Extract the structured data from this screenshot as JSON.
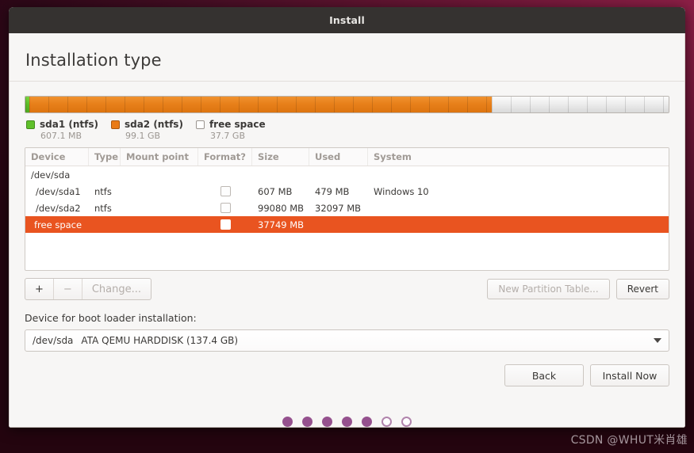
{
  "window": {
    "title": "Install"
  },
  "page": {
    "title": "Installation type"
  },
  "partition_bar": {
    "segments": [
      {
        "name": "sda1",
        "percent": 0.6,
        "color": "#5cbb28"
      },
      {
        "name": "sda2",
        "percent": 71.9,
        "color": "#e8801a"
      },
      {
        "name": "free space",
        "percent": 27.5,
        "color": "#e5e5e5"
      }
    ]
  },
  "legend": [
    {
      "label": "sda1 (ntfs)",
      "size": "607.1 MB",
      "swatch": "green-swatch-icon"
    },
    {
      "label": "sda2 (ntfs)",
      "size": "99.1 GB",
      "swatch": "orange-swatch-icon"
    },
    {
      "label": "free space",
      "size": "37.7 GB",
      "swatch": "white-swatch-icon"
    }
  ],
  "table": {
    "columns": [
      "Device",
      "Type",
      "Mount point",
      "Format?",
      "Size",
      "Used",
      "System"
    ],
    "rows": [
      {
        "device": "/dev/sda",
        "type": "",
        "mount": "",
        "format": false,
        "has_checkbox": false,
        "size": "",
        "used": "",
        "system": "",
        "selected": false
      },
      {
        "device": "/dev/sda1",
        "type": "ntfs",
        "mount": "",
        "format": false,
        "has_checkbox": true,
        "size": "607 MB",
        "used": "479 MB",
        "system": "Windows 10",
        "selected": false
      },
      {
        "device": "/dev/sda2",
        "type": "ntfs",
        "mount": "",
        "format": false,
        "has_checkbox": true,
        "size": "99080 MB",
        "used": "32097 MB",
        "system": "",
        "selected": false
      },
      {
        "device": "free space",
        "type": "",
        "mount": "",
        "format": false,
        "has_checkbox": true,
        "size": "37749 MB",
        "used": "",
        "system": "",
        "selected": true
      }
    ]
  },
  "actions": {
    "add_label": "+",
    "remove_label": "−",
    "change_label": "Change...",
    "new_partition_table_label": "New Partition Table...",
    "revert_label": "Revert"
  },
  "bootloader": {
    "label": "Device for boot loader installation:",
    "selected_device": "/dev/sda",
    "selected_description": "ATA QEMU HARDDISK (137.4 GB)"
  },
  "nav": {
    "back_label": "Back",
    "install_label": "Install Now"
  },
  "progress_dots": {
    "total": 7,
    "filled": 5,
    "filled_color": "#95518e"
  },
  "watermark": {
    "text": "CSDN @WHUT米肖雄"
  }
}
